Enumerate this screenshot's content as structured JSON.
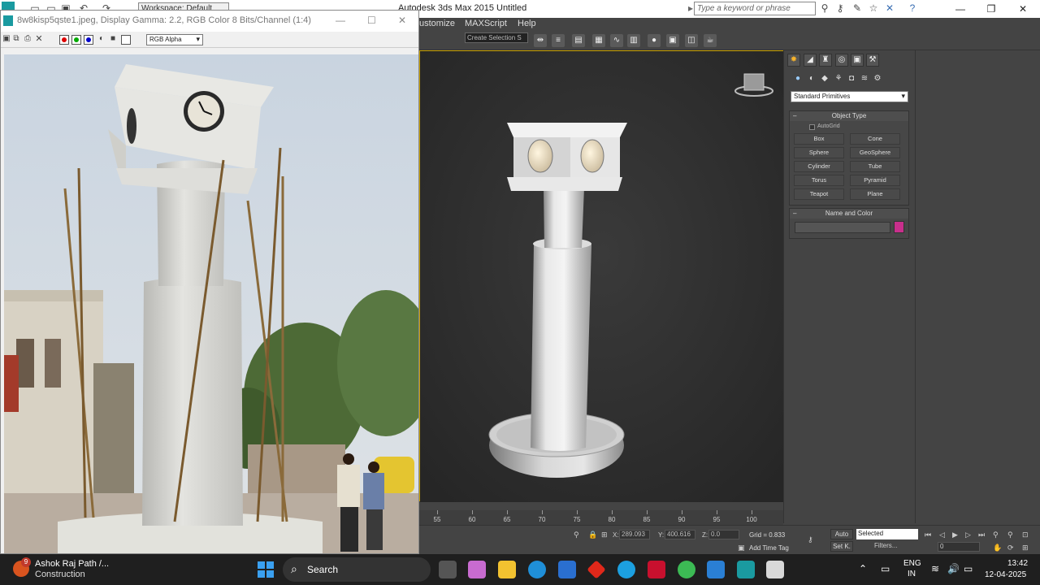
{
  "max_window": {
    "title": "Autodesk 3ds Max  2015",
    "doc_title": "Untitled",
    "workspace": "Workspace: Default",
    "search_placeholder": "Type a keyword or phrase",
    "menu": [
      "ustomize",
      "MAXScript",
      "Help"
    ],
    "toolbar": {
      "selection_set": "Create Selection S"
    }
  },
  "command_panel": {
    "primitive_dropdown": "Standard Primitives",
    "object_type": {
      "title": "Object Type",
      "autogrid": "AutoGrid",
      "buttons": [
        "Box",
        "Cone",
        "Sphere",
        "GeoSphere",
        "Cylinder",
        "Tube",
        "Torus",
        "Pyramid",
        "Teapot",
        "Plane"
      ]
    },
    "name_color": {
      "title": "Name and Color",
      "color": "#c82f8c"
    }
  },
  "timeline": {
    "ticks": [
      "55",
      "60",
      "65",
      "70",
      "75",
      "80",
      "85",
      "90",
      "95",
      "100"
    ]
  },
  "status": {
    "x_label": "X:",
    "x_value": "289.093",
    "y_label": "Y:",
    "y_value": "400.616",
    "z_label": "Z:",
    "z_value": "0.0",
    "grid": "Grid = 0.833",
    "add_time_tag": "Add Time Tag",
    "auto": "Auto",
    "setk": "Set K.",
    "selected": "Selected",
    "filters": "Filters...",
    "frame": "0"
  },
  "viewer": {
    "title": "8w8kisp5qste1.jpeg, Display Gamma: 2.2, RGB Color 8 Bits/Channel (1:4)",
    "channel_select": "RGB Alpha"
  },
  "taskbar": {
    "user_name": "Ashok Raj Path /...",
    "user_sub": "Construction",
    "badge": "9",
    "search": "Search",
    "lang1": "ENG",
    "lang2": "IN",
    "time": "13:42",
    "date": "12-04-2025"
  }
}
